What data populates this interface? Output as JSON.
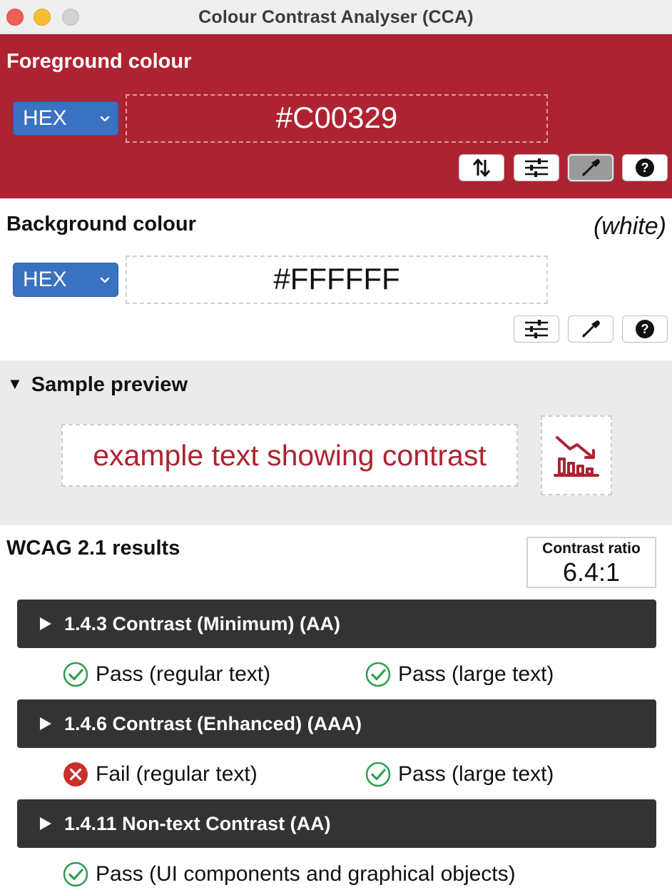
{
  "window": {
    "title": "Colour Contrast Analyser (CCA)"
  },
  "foreground": {
    "title": "Foreground colour",
    "format": "HEX",
    "value": "#C00329",
    "tools": [
      "swap-icon",
      "sliders-icon",
      "eyedropper-icon",
      "help-icon"
    ]
  },
  "background": {
    "title": "Background colour",
    "color_name": "(white)",
    "format": "HEX",
    "value": "#FFFFFF",
    "tools": [
      "sliders-icon",
      "eyedropper-icon",
      "help-icon"
    ]
  },
  "preview": {
    "title": "Sample preview",
    "sample_text": "example text showing contrast"
  },
  "results": {
    "title": "WCAG 2.1 results",
    "ratio_label": "Contrast ratio",
    "ratio_value": "6.4:1",
    "criteria": [
      {
        "label": "1.4.3 Contrast (Minimum) (AA)",
        "outcomes": [
          {
            "status": "pass",
            "text": "Pass (regular text)"
          },
          {
            "status": "pass",
            "text": "Pass (large text)"
          }
        ]
      },
      {
        "label": "1.4.6 Contrast (Enhanced) (AAA)",
        "outcomes": [
          {
            "status": "fail",
            "text": "Fail (regular text)"
          },
          {
            "status": "pass",
            "text": "Pass (large text)"
          }
        ]
      },
      {
        "label": "1.4.11 Non-text Contrast (AA)",
        "outcomes": [
          {
            "status": "pass",
            "text": "Pass (UI components and graphical objects)"
          }
        ]
      }
    ]
  },
  "colors": {
    "foreground": "#C00329",
    "panel": "#AE2331",
    "pass": "#2e9e4f",
    "fail": "#c9302c",
    "select": "#3A72C2",
    "criterion_bar": "#333333"
  }
}
